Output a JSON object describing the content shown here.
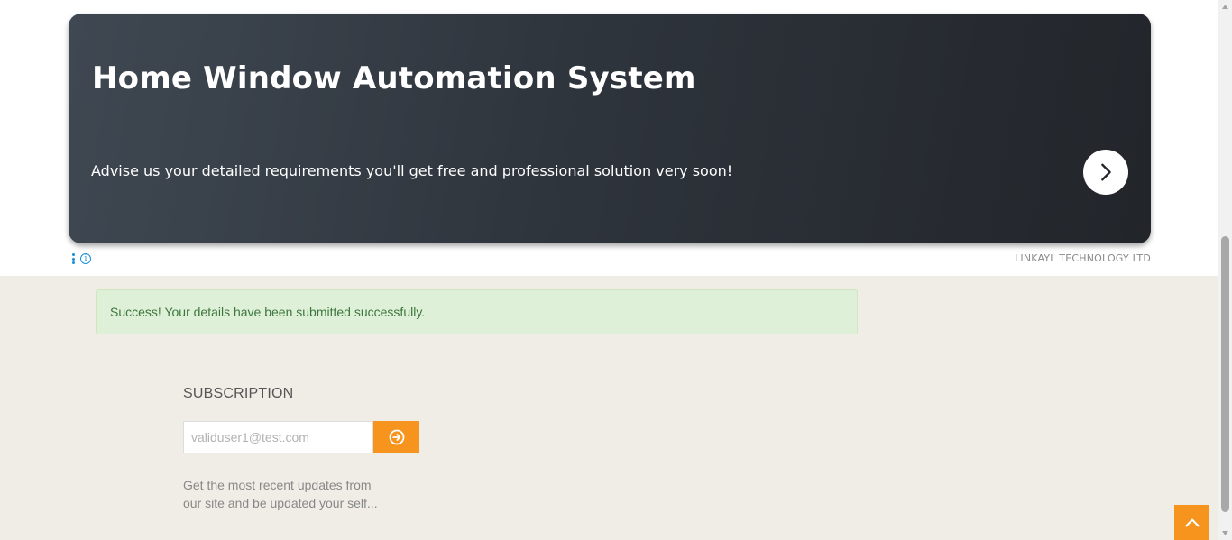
{
  "ad": {
    "title": "Home Window Automation System",
    "description": "Advise us your detailed requirements you'll get free and professional solution very soon!",
    "brand": "LINKAYL TECHNOLOGY LTD",
    "next_icon": "chevron-right-icon",
    "options_icon": "vertical-dots-icon",
    "info_icon": "info-icon",
    "info_glyph": "i"
  },
  "alert": {
    "strong": "Success!",
    "message": " Your details have been submitted successfully."
  },
  "subscription": {
    "title": "SUBSCRIPTION",
    "placeholder": "validuser1@test.com",
    "submit_icon": "circle-arrow-right-icon",
    "description": "Get the most recent updates from our site and be updated your self..."
  },
  "back_to_top_icon": "chevron-up-icon",
  "colors": {
    "accent": "#f7941d",
    "success_bg": "#dff0d8",
    "success_text": "#3c763d",
    "ad_dark": "#22252a",
    "page_bg": "#efede6"
  }
}
